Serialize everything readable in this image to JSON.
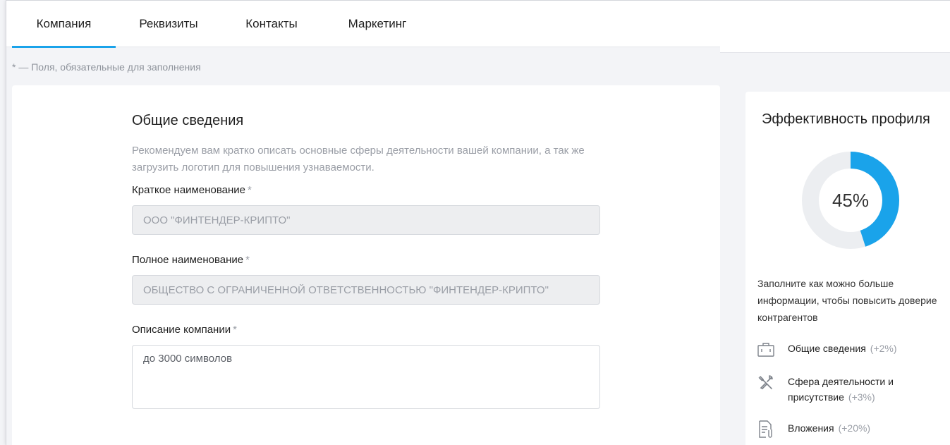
{
  "tabs": [
    {
      "label": "Компания",
      "active": true
    },
    {
      "label": "Реквизиты",
      "active": false
    },
    {
      "label": "Контакты",
      "active": false
    },
    {
      "label": "Маркетинг",
      "active": false
    }
  ],
  "required_note": "* — Поля, обязательные для заполнения",
  "general": {
    "title": "Общие сведения",
    "description": "Рекомендуем вам кратко описать основные сферы деятельности вашей компании, а так же загрузить логотип для повышения узнаваемости.",
    "short_name_label": "Краткое наименование",
    "short_name_value": "ООО \"ФИНТЕНДЕР-КРИПТО\"",
    "full_name_label": "Полное наименование",
    "full_name_value": "ОБЩЕСТВО С ОГРАНИЧЕННОЙ ОТВЕТСТВЕННОСТЬЮ \"ФИНТЕНДЕР-КРИПТО\"",
    "description_label": "Описание компании",
    "description_placeholder": "до 3000 символов",
    "required_mark": "*"
  },
  "efficiency": {
    "title": "Эффективность профиля",
    "percent": 45,
    "percent_label": "45%",
    "hint": "Заполните как можно больше информации, чтобы повысить доверие контрагентов",
    "items": [
      {
        "label": "Общие сведения",
        "bonus": "(+2%)",
        "icon": "briefcase-icon"
      },
      {
        "label": "Сфера деятельности и присутствие",
        "bonus": "(+3%)",
        "icon": "tools-icon"
      },
      {
        "label": "Вложения",
        "bonus": "(+20%)",
        "icon": "attachment-icon"
      }
    ]
  },
  "colors": {
    "accent": "#1aa3ea",
    "donut_track": "#eceef1",
    "muted_text": "#9a9ea6"
  }
}
